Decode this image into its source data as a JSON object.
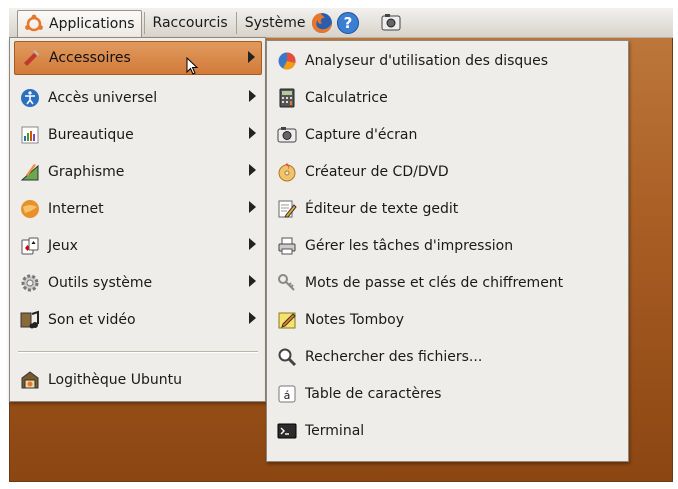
{
  "panel": {
    "applications_label": "Applications",
    "raccourcis_label": "Raccourcis",
    "systeme_label": "Système"
  },
  "categories": [
    {
      "label": "Accessoires",
      "icon": "accessories-icon",
      "submenu": true
    },
    {
      "label": "Accès universel",
      "icon": "accessibility-icon",
      "submenu": true
    },
    {
      "label": "Bureautique",
      "icon": "office-icon",
      "submenu": true
    },
    {
      "label": "Graphisme",
      "icon": "graphics-icon",
      "submenu": true
    },
    {
      "label": "Internet",
      "icon": "internet-icon",
      "submenu": true
    },
    {
      "label": "Jeux",
      "icon": "games-icon",
      "submenu": true
    },
    {
      "label": "Outils système",
      "icon": "system-tools-icon",
      "submenu": true
    },
    {
      "label": "Son et vidéo",
      "icon": "sound-video-icon",
      "submenu": true
    },
    {
      "label": "Logithèque Ubuntu",
      "icon": "software-center-icon",
      "submenu": false
    }
  ],
  "accessories": [
    {
      "label": "Analyseur d'utilisation des disques",
      "icon": "disk-usage-icon"
    },
    {
      "label": "Calculatrice",
      "icon": "calculator-icon"
    },
    {
      "label": "Capture d'écran",
      "icon": "screenshot-icon"
    },
    {
      "label": "Créateur de CD/DVD",
      "icon": "cd-burner-icon"
    },
    {
      "label": "Éditeur de texte gedit",
      "icon": "text-editor-icon"
    },
    {
      "label": "Gérer les tâches d'impression",
      "icon": "printer-icon"
    },
    {
      "label": "Mots de passe et clés de chiffrement",
      "icon": "keys-icon"
    },
    {
      "label": "Notes Tomboy",
      "icon": "notes-icon"
    },
    {
      "label": "Rechercher des fichiers...",
      "icon": "search-icon"
    },
    {
      "label": "Table de caractères",
      "icon": "charmap-icon"
    },
    {
      "label": "Terminal",
      "icon": "terminal-icon"
    }
  ],
  "colors": {
    "highlight": "#d27b3a",
    "desktop": "#a95e24",
    "menu_bg": "#efede9"
  }
}
